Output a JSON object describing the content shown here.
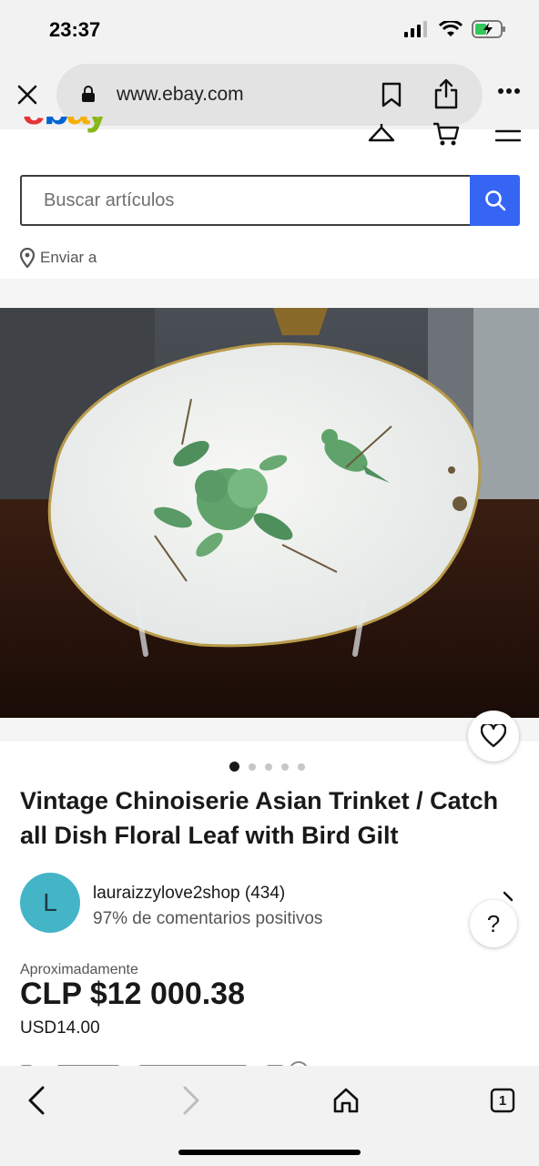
{
  "status": {
    "time": "23:37"
  },
  "browser": {
    "url": "www.ebay.com",
    "tab_count": "1"
  },
  "search": {
    "placeholder": "Buscar artículos"
  },
  "ship_to": {
    "label": "Enviar a"
  },
  "gallery": {
    "image_count": 5,
    "active_index": 0
  },
  "listing": {
    "title": "Vintage Chinoiserie Asian Trinket / Catch all Dish Floral Leaf with Bird Gilt",
    "seller": {
      "initial": "L",
      "name": "lauraizzylove2shop (434)",
      "feedback": "97% de comentarios positivos"
    },
    "price": {
      "approx_label": "Aproximadamente",
      "local": "CLP $12 000.38",
      "usd": "USD14.00"
    }
  },
  "help": {
    "label": "?"
  },
  "colors": {
    "accent": "#3665f3",
    "avatar": "#43b5c7",
    "logo_e": "#e53238",
    "logo_b": "#0064d2",
    "logo_a": "#f5af02",
    "logo_y": "#86b817"
  }
}
